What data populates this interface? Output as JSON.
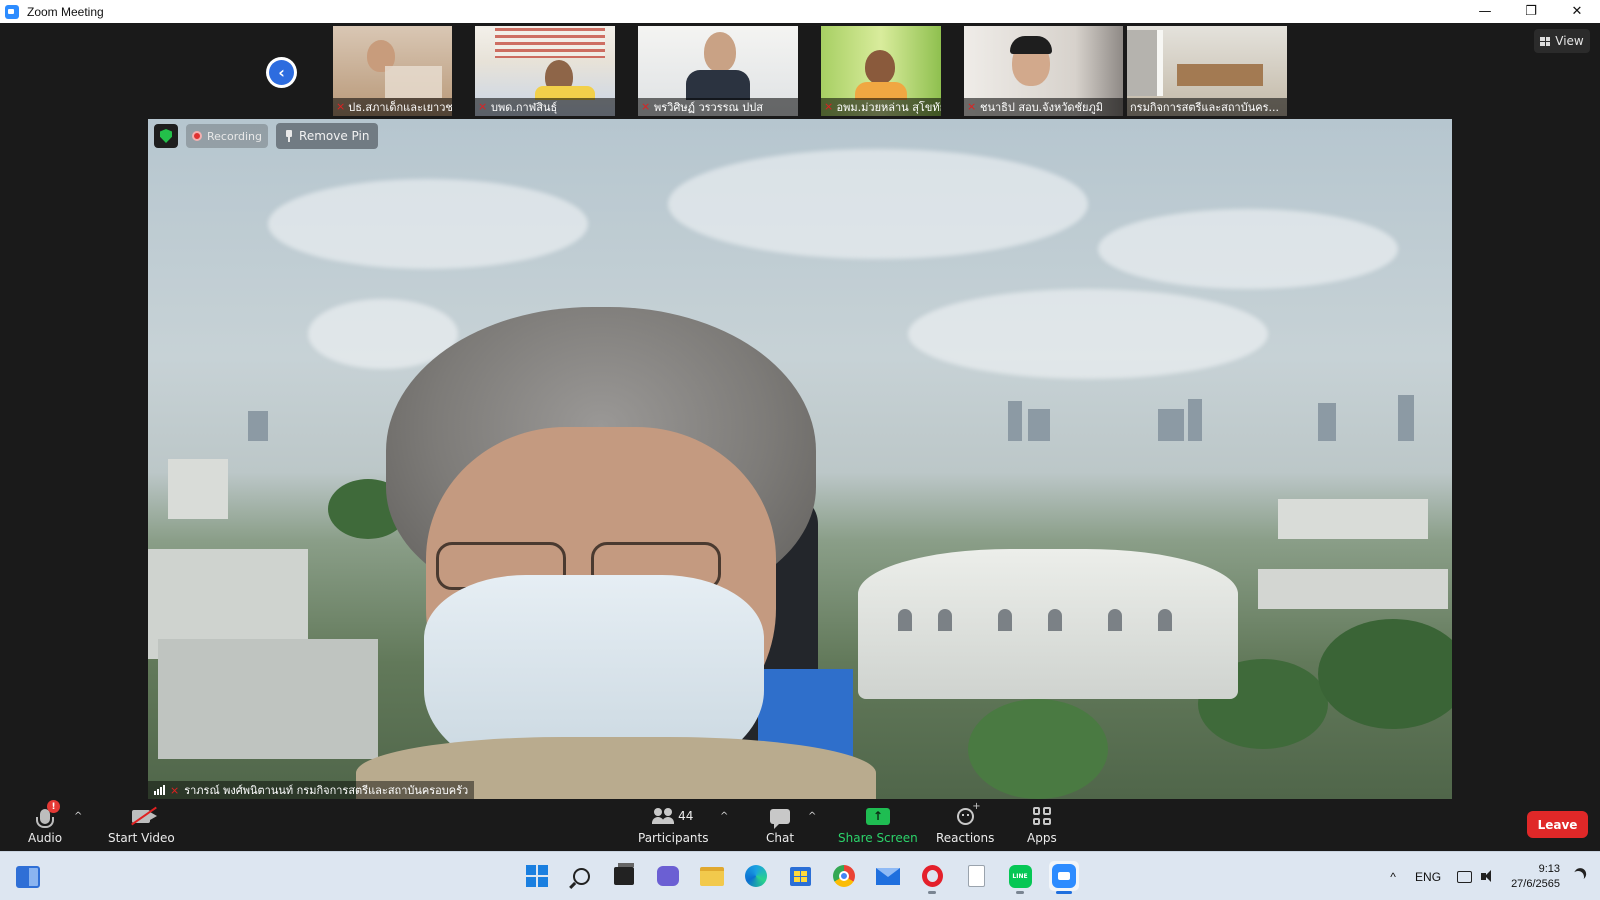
{
  "window": {
    "title": "Zoom Meeting",
    "minimize": "—",
    "restore": "❐",
    "close": "✕"
  },
  "strip": {
    "prev_icon": "chevron-left-icon",
    "thumbnails": [
      {
        "name": "ปธ.สภาเด็กและเยาวชนจัง..."
      },
      {
        "name": "บพด.กาฬสินธุ์"
      },
      {
        "name": "พรวิศิษฏ์ วรวรรณ ปปส"
      },
      {
        "name": "อพม.ม่วยหล่าน สุโขทัย"
      },
      {
        "name": "ชนาธิป สอบ.จังหวัดชัยภูมิ"
      },
      {
        "name": "กรมกิจการสตรีและสถาบันคร..."
      }
    ]
  },
  "view_button": {
    "label": "View"
  },
  "main_video": {
    "recording_label": "Recording",
    "unpin_label": "Remove Pin",
    "speaker_name": "ราภรณ์ พงศ์พนิตานนท์ กรมกิจการสตรีและสถาบันครอบครัว"
  },
  "toolbar": {
    "audio": "Audio",
    "audio_alert": "!",
    "start_video": "Start Video",
    "participants": "Participants",
    "participant_count": "44",
    "chat": "Chat",
    "share_screen": "Share Screen",
    "share_arrow": "↑",
    "reactions": "Reactions",
    "apps": "Apps",
    "leave": "Leave",
    "caret": "^"
  },
  "taskbar": {
    "line_label": "LINE",
    "tray_chevron": "^",
    "language": "ENG",
    "time": "9:13",
    "date": "27/6/2565"
  },
  "colors": {
    "accent": "#2d8cff",
    "leave": "#e02828",
    "share": "#1fbd52",
    "mic_off": "#e02020"
  }
}
